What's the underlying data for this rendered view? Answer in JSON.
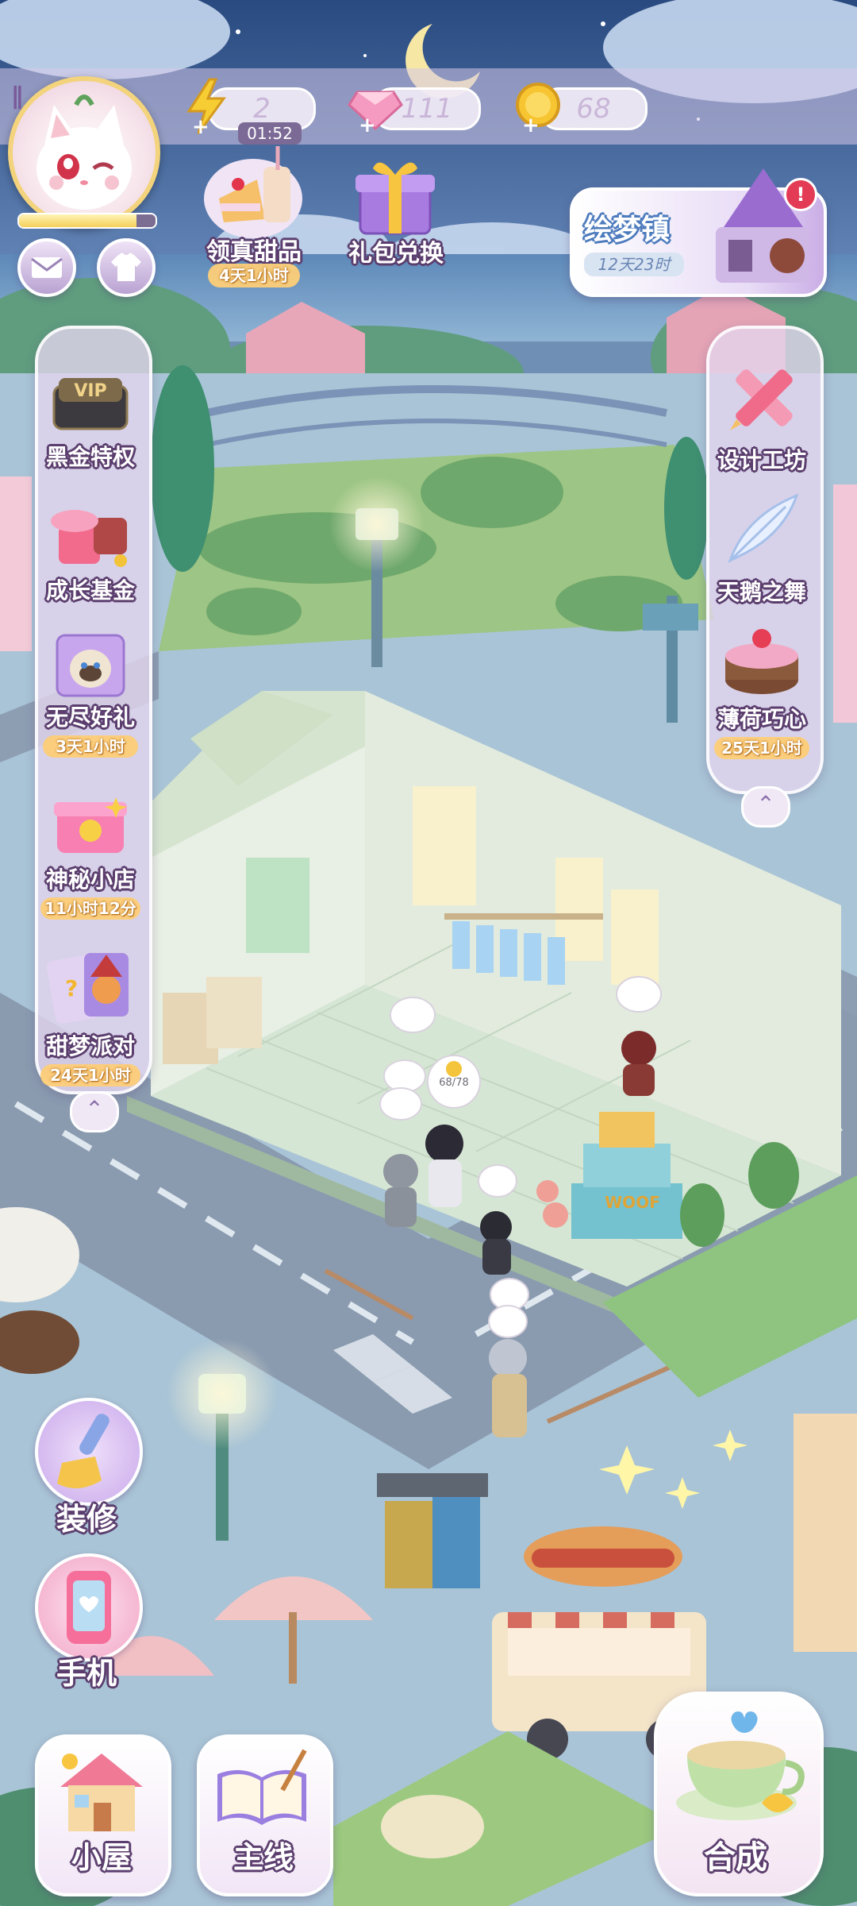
{
  "top_bar": {
    "energy_value": "2",
    "energy_timer": "01:52",
    "gems_value": "111",
    "coins_value": "68"
  },
  "events": {
    "dessert_label": "领真甜品",
    "dessert_timer": "4天1小时",
    "gift_label": "礼包兑换",
    "town_name": "绘梦镇",
    "town_timer": "12天23时"
  },
  "left_menu": [
    {
      "label": "黑金特权",
      "timer": ""
    },
    {
      "label": "成长基金",
      "timer": ""
    },
    {
      "label": "无尽好礼",
      "timer": "3天1小时"
    },
    {
      "label": "神秘小店",
      "timer": "11小时12分"
    },
    {
      "label": "甜梦派对",
      "timer": "24天1小时"
    }
  ],
  "right_menu": [
    {
      "label": "设计工坊",
      "timer": ""
    },
    {
      "label": "天鹅之舞",
      "timer": ""
    },
    {
      "label": "薄荷巧心",
      "timer": "25天1小时"
    }
  ],
  "vip_text": "VIP",
  "scene": {
    "progress_bubble": "68/78",
    "cake_sign": "WOOF"
  },
  "side_buttons": {
    "decorate": "装修",
    "phone": "手机"
  },
  "bottom_nav": {
    "house": "小屋",
    "mainline": "主线",
    "merge": "合成"
  },
  "colors": {
    "sky_night": "#2f4f86",
    "panel": "#e4d6ee",
    "label_outline": "#5b3e6e",
    "timer_bg": "#fdcd78",
    "floor": "#d8e8d6",
    "road": "#8a9bb0"
  }
}
